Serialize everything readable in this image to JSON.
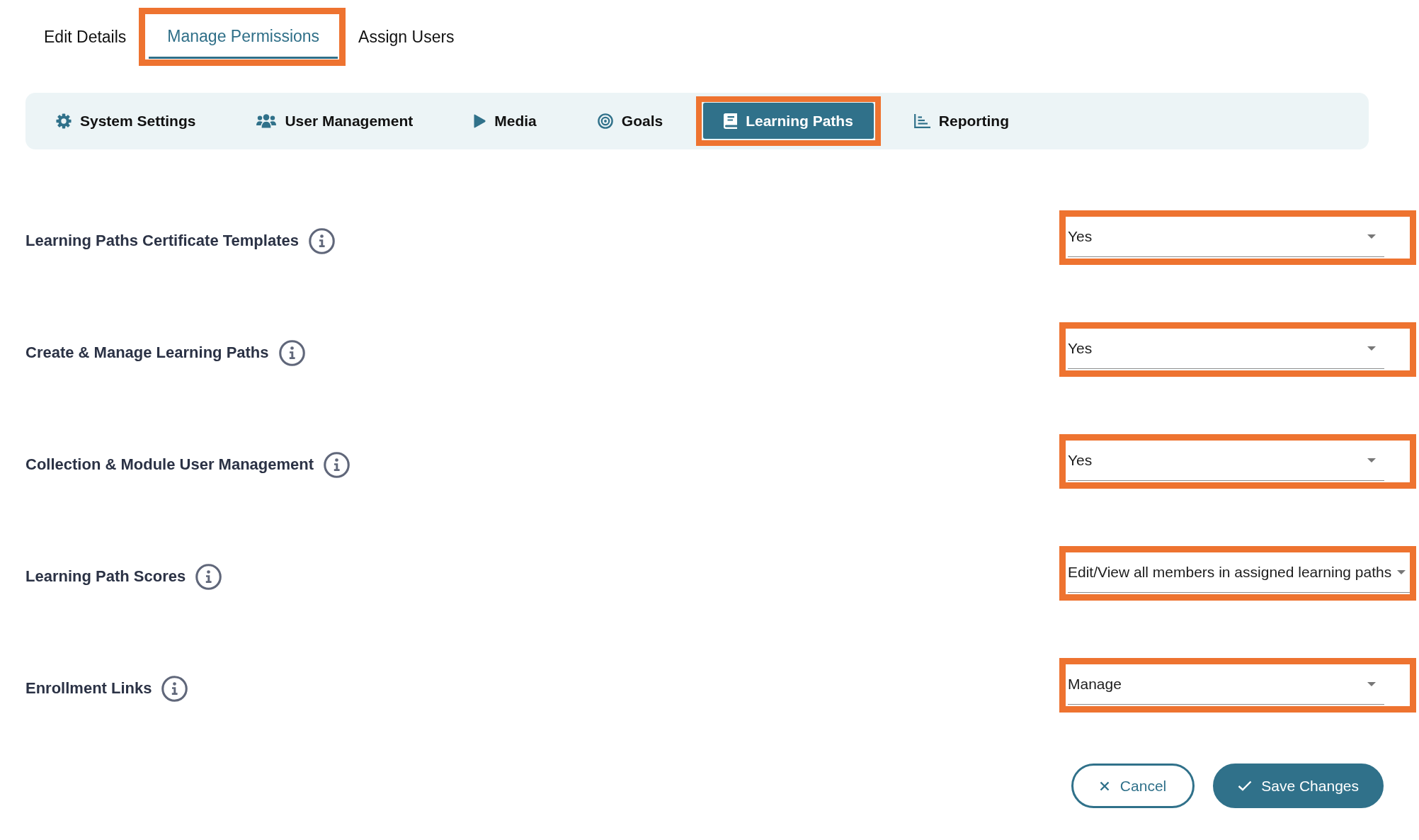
{
  "tabs": [
    {
      "label": "Edit Details",
      "selected": false,
      "highlighted": false
    },
    {
      "label": "Manage Permissions",
      "selected": true,
      "highlighted": true
    },
    {
      "label": "Assign Users",
      "selected": false,
      "highlighted": false
    }
  ],
  "categories": [
    {
      "kind": "settings",
      "label": "System Settings",
      "selected": false,
      "highlighted": false
    },
    {
      "kind": "users",
      "label": "User Management",
      "selected": false,
      "highlighted": false
    },
    {
      "kind": "media",
      "label": "Media",
      "selected": false,
      "highlighted": false
    },
    {
      "kind": "goals",
      "label": "Goals",
      "selected": false,
      "highlighted": false
    },
    {
      "kind": "paths",
      "label": "Learning Paths",
      "selected": true,
      "highlighted": true
    },
    {
      "kind": "reporting",
      "label": "Reporting",
      "selected": false,
      "highlighted": false
    }
  ],
  "permissions": [
    {
      "label": "Learning Paths Certificate Templates",
      "value": "Yes",
      "highlighted": true
    },
    {
      "label": "Create & Manage Learning Paths",
      "value": "Yes",
      "highlighted": true
    },
    {
      "label": "Collection & Module User Management",
      "value": "Yes",
      "highlighted": true
    },
    {
      "label": "Learning Path Scores",
      "value": "Edit/View all members in assigned learning paths",
      "highlighted": true
    },
    {
      "label": "Enrollment Links",
      "value": "Manage",
      "highlighted": true
    }
  ],
  "buttons": [
    {
      "kind": "cancel",
      "label": "Cancel"
    },
    {
      "kind": "save",
      "label": "Save Changes"
    }
  ]
}
